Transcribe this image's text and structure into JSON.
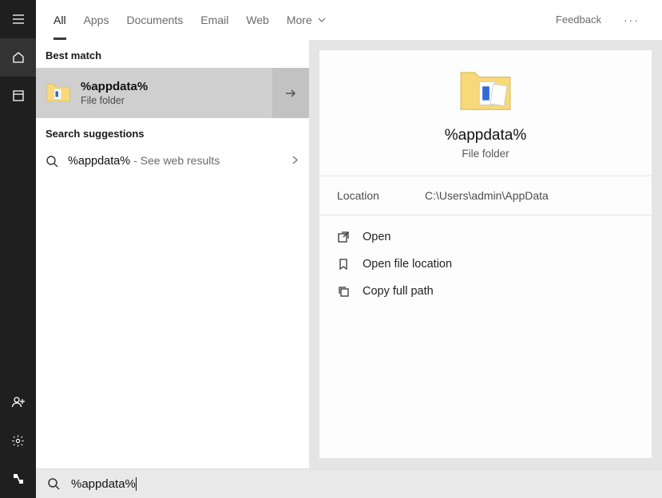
{
  "sidebar": {
    "items": [
      "menu",
      "home",
      "timeline",
      "user",
      "settings",
      "share"
    ]
  },
  "tabs": {
    "items": [
      "All",
      "Apps",
      "Documents",
      "Email",
      "Web",
      "More"
    ],
    "feedback": "Feedback"
  },
  "results": {
    "best_match_header": "Best match",
    "best_match": {
      "title": "%appdata%",
      "subtitle": "File folder"
    },
    "suggestions_header": "Search suggestions",
    "suggestion": {
      "query": "%appdata%",
      "tail": " - See web results"
    }
  },
  "preview": {
    "title": "%appdata%",
    "subtitle": "File folder",
    "meta_label": "Location",
    "meta_value": "C:\\Users\\admin\\AppData",
    "actions": {
      "open": "Open",
      "open_loc": "Open file location",
      "copy": "Copy full path"
    }
  },
  "search": {
    "value": "%appdata%"
  }
}
